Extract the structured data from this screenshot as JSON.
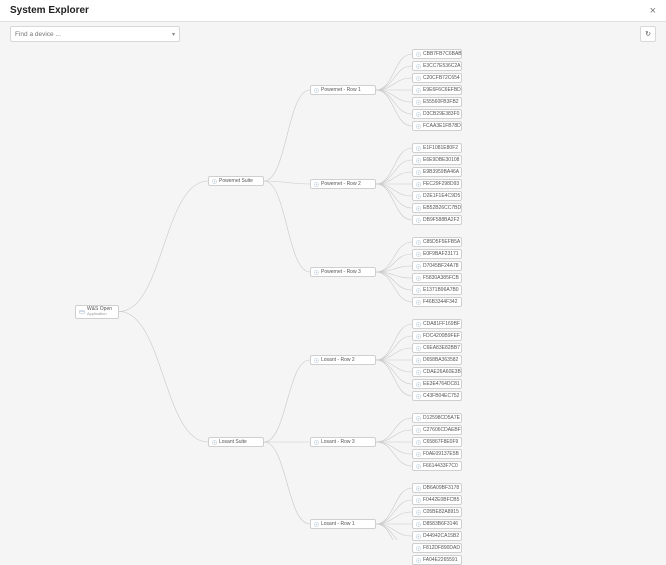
{
  "header": {
    "title": "System Explorer"
  },
  "search": {
    "placeholder": "Find a device ...",
    "value": ""
  },
  "icons": {
    "close": "×",
    "chevron_down": "▾",
    "refresh": "↻"
  },
  "tree": {
    "root": {
      "label": "W&S Open",
      "sub": "Application"
    },
    "level2": [
      {
        "label": "Powernet Suite"
      },
      {
        "label": "Losant Suite"
      }
    ],
    "level3": {
      "powernet": [
        {
          "label": "Powernet - Row 1"
        },
        {
          "label": "Powernet - Row 2"
        },
        {
          "label": "Powernet - Row 3"
        }
      ],
      "losant": [
        {
          "label": "Losant - Row 2"
        },
        {
          "label": "Losant - Row 3"
        },
        {
          "label": "Losant - Row 1"
        }
      ]
    },
    "leaves": {
      "pr1": [
        "CBB7FB7C6BAB",
        "E3CC7E536C2A",
        "C20CFB72C654",
        "E9E6F6C6EFBD",
        "E55560FB3FB2",
        "D3CB29E383F0",
        "FCAA3E1FB78D"
      ],
      "pr2": [
        "E1F1081E80F2",
        "E6E9DBE30108",
        "E9B3959BA46A",
        "FEC29F298D93",
        "D2E1F1E4C9D5",
        "EB52B26CC7BD",
        "DB9F588BA2F2"
      ],
      "pr3": [
        "C85D5F5EFB5A",
        "E0F9BAF23171",
        "D7045BF24A78",
        "F5830A385FCB",
        "E1371B96A7B0",
        "F46B3344F342"
      ],
      "lr2": [
        "CDA81FF169BF",
        "FDC4200B9FEF",
        "C6EA83E82BB7",
        "D658BA363582",
        "CDAE26A60E3B",
        "EE3E4764DC81",
        "C43FB04EC752"
      ],
      "lr3": [
        "D12598CD5A7E",
        "C27606CDAEBF",
        "C65867F8E0F9",
        "F0AE09137E5B",
        "F6614433F7C0"
      ],
      "lr1": [
        "DB6A09BF3178",
        "F0442E0BFCB5",
        "C05BE82A8915",
        "D8583B6F3146",
        "D44942CA15B2",
        "F812DF890DAD",
        "FA04E2265591"
      ]
    }
  }
}
